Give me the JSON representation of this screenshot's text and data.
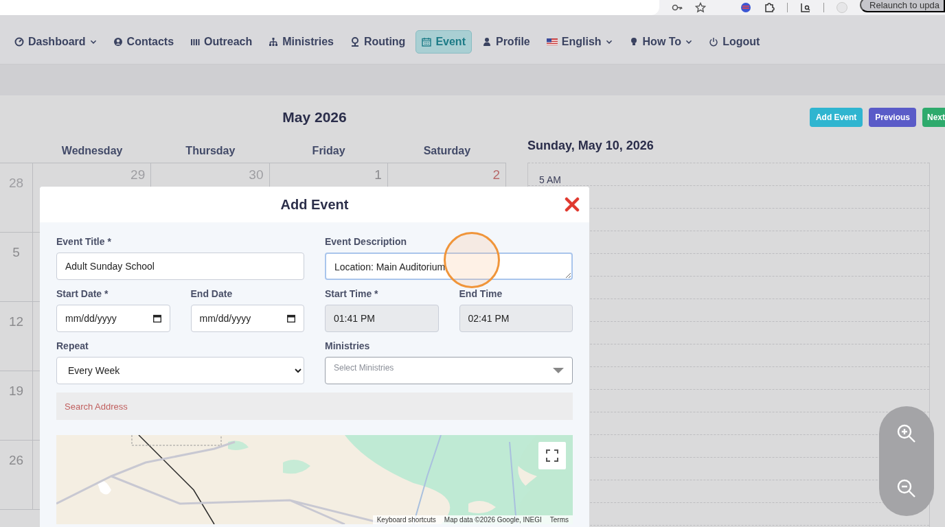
{
  "browser": {
    "update_button": "Relaunch to upda"
  },
  "nav": [
    {
      "label": "Dashboard",
      "dropdown": true,
      "selected": false
    },
    {
      "label": "Contacts",
      "dropdown": false,
      "selected": false
    },
    {
      "label": "Outreach",
      "dropdown": false,
      "selected": false
    },
    {
      "label": "Ministries",
      "dropdown": false,
      "selected": false
    },
    {
      "label": "Routing",
      "dropdown": false,
      "selected": false
    },
    {
      "label": "Event",
      "dropdown": false,
      "selected": true
    },
    {
      "label": "Profile",
      "dropdown": false,
      "selected": false
    },
    {
      "label": "English",
      "dropdown": true,
      "selected": false
    },
    {
      "label": "How To",
      "dropdown": true,
      "selected": false
    },
    {
      "label": "Logout",
      "dropdown": false,
      "selected": false
    }
  ],
  "calendar": {
    "title": "May 2026",
    "buttons": [
      {
        "label": "Add Event",
        "color": "#2fb5d0"
      },
      {
        "label": "Previous",
        "color": "#5a5bc8"
      },
      {
        "label": "Next",
        "color": "#2eaa6c"
      }
    ],
    "weekdays": [
      "Wednesday",
      "Thursday",
      "Friday",
      "Saturday"
    ],
    "weeks": [
      {
        "days": [
          {
            "day": "28",
            "kind": "other_month"
          },
          {
            "day": "29",
            "kind": "other_month"
          },
          {
            "day": "30",
            "kind": "other_month"
          },
          {
            "day": "1",
            "kind": "current"
          },
          {
            "day": "2",
            "kind": "saturday"
          }
        ]
      },
      {
        "days": [
          {
            "day": "5",
            "kind": "current"
          }
        ]
      },
      {
        "days": [
          {
            "day": "12",
            "kind": "current"
          }
        ]
      },
      {
        "days": [
          {
            "day": "19",
            "kind": "current"
          }
        ]
      },
      {
        "days": [
          {
            "day": "26",
            "kind": "current"
          }
        ]
      }
    ]
  },
  "day_view": {
    "title": "Sunday, May 10, 2026",
    "hours": [
      "5 AM"
    ]
  },
  "modal": {
    "title": "Add Event",
    "rows": [
      [
        {
          "label": "Event Title *",
          "kind": "text",
          "value": "Adult Sunday School",
          "focused": false,
          "disabled": false
        },
        {
          "label": "Event Description",
          "kind": "textarea",
          "value": "Location: Main Auditorium",
          "focused": true,
          "disabled": false
        }
      ],
      [
        {
          "label": "Start Date *",
          "kind": "date",
          "value": "mm/dd/yyyy",
          "focused": false,
          "disabled": false
        },
        {
          "label": "End Date",
          "kind": "date",
          "value": "mm/dd/yyyy",
          "focused": false,
          "disabled": false
        },
        {
          "label": "Start Time *",
          "kind": "text",
          "value": "01:41 PM",
          "focused": false,
          "disabled": true
        },
        {
          "label": "End Time",
          "kind": "text",
          "value": "02:41 PM",
          "focused": false,
          "disabled": true
        }
      ],
      [
        {
          "label": "Repeat",
          "kind": "select",
          "value": "Every Week",
          "focused": false,
          "disabled": false
        },
        {
          "label": "Ministries",
          "kind": "multiselect",
          "placeholder": "Select Ministries",
          "focused": false,
          "disabled": false
        }
      ]
    ],
    "search": {
      "placeholder": "Search Address"
    },
    "map": {
      "kind": "picture",
      "attribution": [
        "Keyboard shortcuts",
        "Map data ©2026 Google, INEGI",
        "Terms"
      ]
    }
  }
}
